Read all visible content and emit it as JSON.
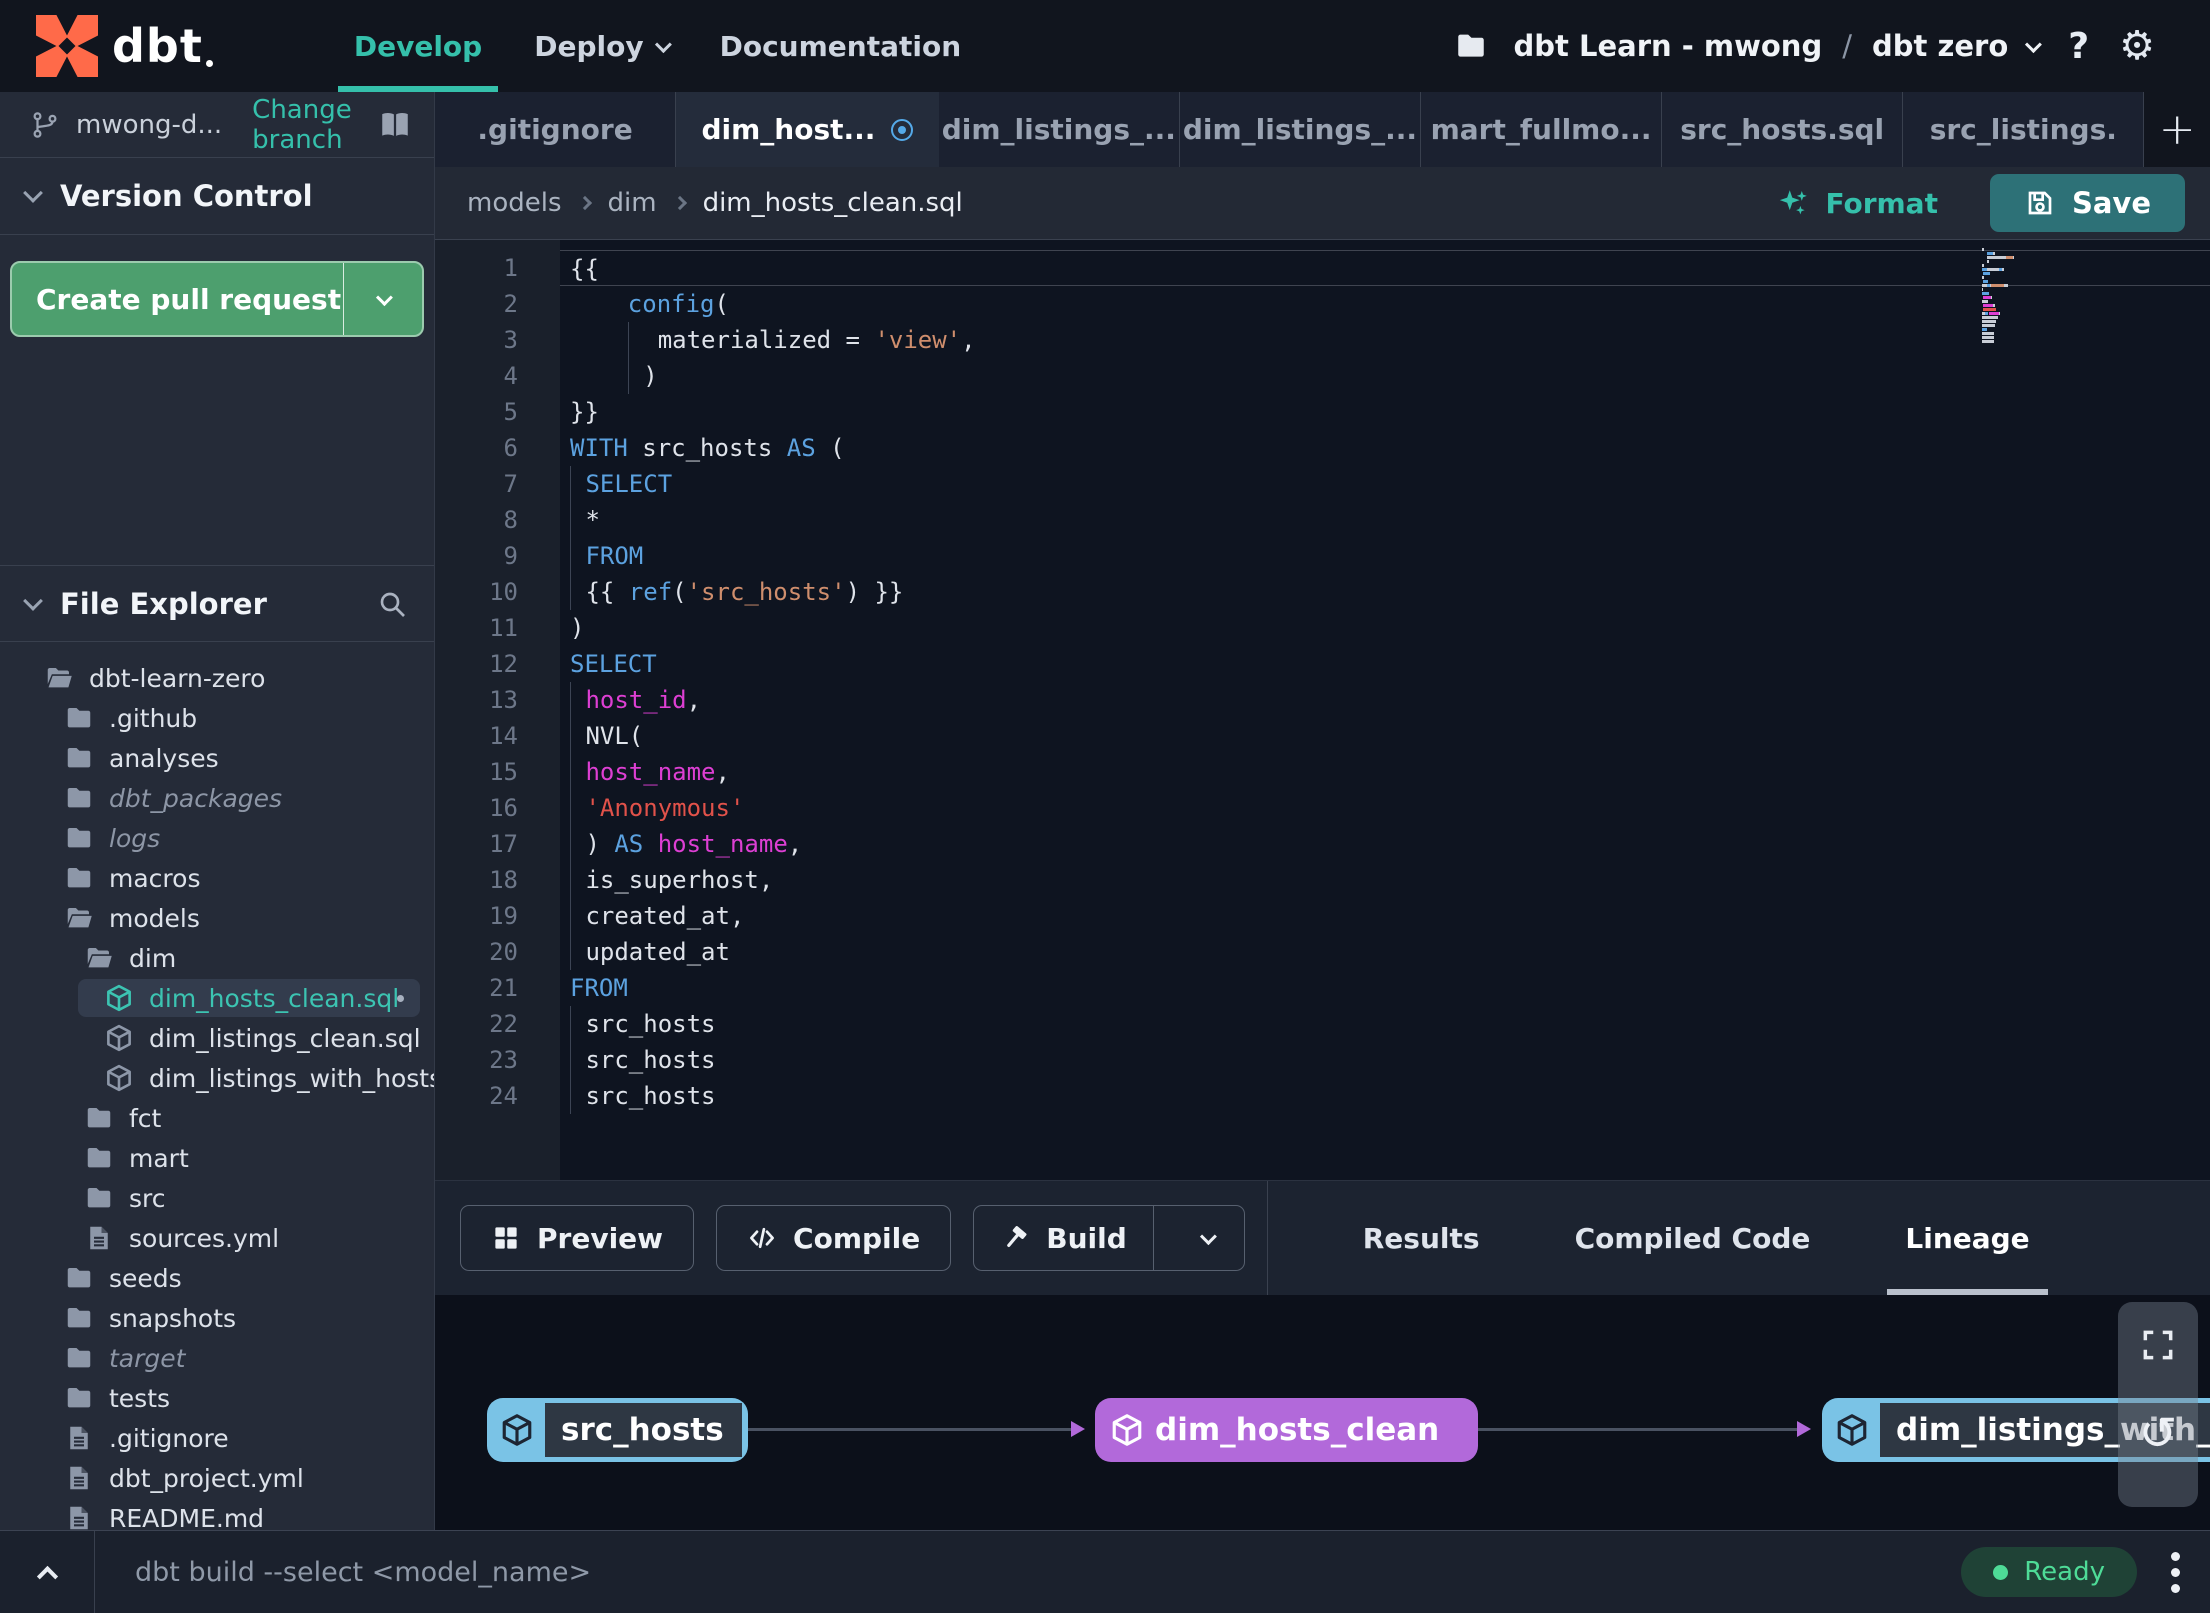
{
  "colors": {
    "accent_teal": "#35c0ab",
    "brand_orange": "#ff6a49",
    "save_teal": "#2d7177",
    "pr_green": "#4d9f6e",
    "node_blue": "#7ac3e6",
    "node_purple": "#b269da",
    "keyword_blue": "#5ca2e0",
    "string_orange": "#cf8e6d",
    "string_red": "#e1524a",
    "ident_magenta": "#dd3fd3",
    "ready_green": "#4edb97",
    "tab_dot_blue": "#54a9e8"
  },
  "icons_text": {
    "gear": "⚙",
    "refresh": "↺",
    "plus": "+"
  },
  "topnav": {
    "brand": "dbt",
    "nav": [
      {
        "label": "Develop",
        "active": true
      },
      {
        "label": "Deploy",
        "has_chevron": true
      },
      {
        "label": "Documentation"
      }
    ],
    "project": {
      "account": "dbt Learn - mwong",
      "separator": "/",
      "name": "dbt zero"
    },
    "help_label": "?"
  },
  "sidebar": {
    "branch": {
      "name": "mwong-d...",
      "change_label": "Change branch"
    },
    "version_control_label": "Version Control",
    "create_pr_label": "Create pull request",
    "file_explorer_label": "File Explorer",
    "tree": [
      {
        "label": "dbt-learn-zero",
        "icon": "folder-open",
        "depth": 0
      },
      {
        "label": ".github",
        "icon": "folder",
        "depth": 1
      },
      {
        "label": "analyses",
        "icon": "folder",
        "depth": 1
      },
      {
        "label": "dbt_packages",
        "icon": "folder",
        "depth": 1,
        "italic": true
      },
      {
        "label": "logs",
        "icon": "folder",
        "depth": 1,
        "italic": true
      },
      {
        "label": "macros",
        "icon": "folder",
        "depth": 1
      },
      {
        "label": "models",
        "icon": "folder-open",
        "depth": 1
      },
      {
        "label": "dim",
        "icon": "folder-open",
        "depth": 2
      },
      {
        "label": "dim_hosts_clean.sql",
        "icon": "model",
        "depth": 3,
        "selected": true,
        "modified": true
      },
      {
        "label": "dim_listings_clean.sql",
        "icon": "model",
        "depth": 3
      },
      {
        "label": "dim_listings_with_hosts...",
        "icon": "model",
        "depth": 3
      },
      {
        "label": "fct",
        "icon": "folder",
        "depth": 2
      },
      {
        "label": "mart",
        "icon": "folder",
        "depth": 2
      },
      {
        "label": "src",
        "icon": "folder",
        "depth": 2
      },
      {
        "label": "sources.yml",
        "icon": "file",
        "depth": 2
      },
      {
        "label": "seeds",
        "icon": "folder",
        "depth": 1
      },
      {
        "label": "snapshots",
        "icon": "folder",
        "depth": 1
      },
      {
        "label": "target",
        "icon": "folder",
        "depth": 1,
        "italic": true
      },
      {
        "label": "tests",
        "icon": "folder",
        "depth": 1
      },
      {
        "label": ".gitignore",
        "icon": "file",
        "depth": 1
      },
      {
        "label": "dbt_project.yml",
        "icon": "file",
        "depth": 1
      },
      {
        "label": "README.md",
        "icon": "file",
        "depth": 1
      }
    ]
  },
  "tabs": {
    "items": [
      {
        "label": ".gitignore"
      },
      {
        "label": "dim_host...",
        "active": true,
        "modified": true
      },
      {
        "label": "dim_listings_..."
      },
      {
        "label": "dim_listings_..."
      },
      {
        "label": "mart_fullmo..."
      },
      {
        "label": "src_hosts.sql"
      },
      {
        "label": "src_listings."
      }
    ],
    "add_label": "+"
  },
  "editorbar": {
    "breadcrumb": [
      "models",
      "dim",
      "dim_hosts_clean.sql"
    ],
    "format_label": "Format",
    "save_label": "Save"
  },
  "editor": {
    "lines": [
      {
        "n": 1,
        "active": true,
        "tokens": [
          [
            "{{",
            "p"
          ]
        ]
      },
      {
        "n": 2,
        "tokens": [
          [
            "    ",
            "p"
          ],
          [
            "config",
            "k"
          ],
          [
            "(",
            "p"
          ]
        ]
      },
      {
        "n": 3,
        "tokens": [
          [
            "    ",
            "p"
          ],
          [
            "",
            "g"
          ],
          [
            "  materialized = ",
            "p"
          ],
          [
            "'view'",
            "s"
          ],
          [
            ",",
            "p"
          ]
        ]
      },
      {
        "n": 4,
        "tokens": [
          [
            "    ",
            "p"
          ],
          [
            "",
            "g"
          ],
          [
            " )",
            "p"
          ]
        ]
      },
      {
        "n": 5,
        "tokens": [
          [
            "}}",
            "p"
          ]
        ]
      },
      {
        "n": 6,
        "tokens": [
          [
            "WITH",
            "k"
          ],
          [
            " src_hosts ",
            "p"
          ],
          [
            "AS",
            "k"
          ],
          [
            " (",
            "p"
          ]
        ]
      },
      {
        "n": 7,
        "tokens": [
          [
            "",
            "g"
          ],
          [
            " ",
            "p"
          ],
          [
            "SELECT",
            "k"
          ]
        ]
      },
      {
        "n": 8,
        "tokens": [
          [
            "",
            "g"
          ],
          [
            " *",
            "p"
          ]
        ]
      },
      {
        "n": 9,
        "tokens": [
          [
            "",
            "g"
          ],
          [
            " ",
            "p"
          ],
          [
            "FROM",
            "k"
          ]
        ]
      },
      {
        "n": 10,
        "tokens": [
          [
            "",
            "g"
          ],
          [
            " {{ ",
            "p"
          ],
          [
            "ref",
            "k"
          ],
          [
            "(",
            "p"
          ],
          [
            "'src_hosts'",
            "s"
          ],
          [
            ")",
            "p"
          ],
          [
            " }}",
            "p"
          ]
        ]
      },
      {
        "n": 11,
        "tokens": [
          [
            ")",
            "p"
          ]
        ]
      },
      {
        "n": 12,
        "tokens": [
          [
            "SELECT",
            "k"
          ]
        ]
      },
      {
        "n": 13,
        "tokens": [
          [
            "",
            "g"
          ],
          [
            " ",
            "p"
          ],
          [
            "host_id",
            "m"
          ],
          [
            ",",
            "p"
          ]
        ]
      },
      {
        "n": 14,
        "tokens": [
          [
            "",
            "g"
          ],
          [
            " NVL(",
            "p"
          ]
        ]
      },
      {
        "n": 15,
        "tokens": [
          [
            "",
            "g"
          ],
          [
            " ",
            "p"
          ],
          [
            "host_name",
            "m"
          ],
          [
            ",",
            "p"
          ]
        ]
      },
      {
        "n": 16,
        "tokens": [
          [
            "",
            "g"
          ],
          [
            " ",
            "p"
          ],
          [
            "'Anonymous'",
            "r"
          ]
        ]
      },
      {
        "n": 17,
        "tokens": [
          [
            "",
            "g"
          ],
          [
            " ) ",
            "p"
          ],
          [
            "AS",
            "k"
          ],
          [
            " ",
            "p"
          ],
          [
            "host_name",
            "m"
          ],
          [
            ",",
            "p"
          ]
        ]
      },
      {
        "n": 18,
        "tokens": [
          [
            "",
            "g"
          ],
          [
            " is_superhost,",
            "p"
          ]
        ]
      },
      {
        "n": 19,
        "tokens": [
          [
            "",
            "g"
          ],
          [
            " created_at,",
            "p"
          ]
        ]
      },
      {
        "n": 20,
        "tokens": [
          [
            "",
            "g"
          ],
          [
            " updated_at",
            "p"
          ]
        ]
      },
      {
        "n": 21,
        "tokens": [
          [
            "FROM",
            "k"
          ]
        ]
      },
      {
        "n": 22,
        "tokens": [
          [
            "",
            "g"
          ],
          [
            " src_hosts",
            "p"
          ]
        ]
      },
      {
        "n": 23,
        "tokens": [
          [
            "",
            "g"
          ],
          [
            " src_hosts",
            "p"
          ]
        ]
      },
      {
        "n": 24,
        "tokens": [
          [
            "",
            "g"
          ],
          [
            " src_hosts",
            "p"
          ]
        ]
      }
    ]
  },
  "toolbar": {
    "preview_label": "Preview",
    "compile_label": "Compile",
    "build_label": "Build",
    "tabs": [
      {
        "label": "Results"
      },
      {
        "label": "Compiled Code"
      },
      {
        "label": "Lineage",
        "active": true
      }
    ]
  },
  "lineage": {
    "nodes": [
      {
        "label": "src_hosts",
        "type": "source"
      },
      {
        "label": "dim_hosts_clean",
        "type": "model"
      },
      {
        "label": "dim_listings_with_h",
        "type": "source"
      }
    ]
  },
  "statusbar": {
    "command_placeholder": "dbt build --select <model_name>",
    "ready_label": "Ready"
  }
}
